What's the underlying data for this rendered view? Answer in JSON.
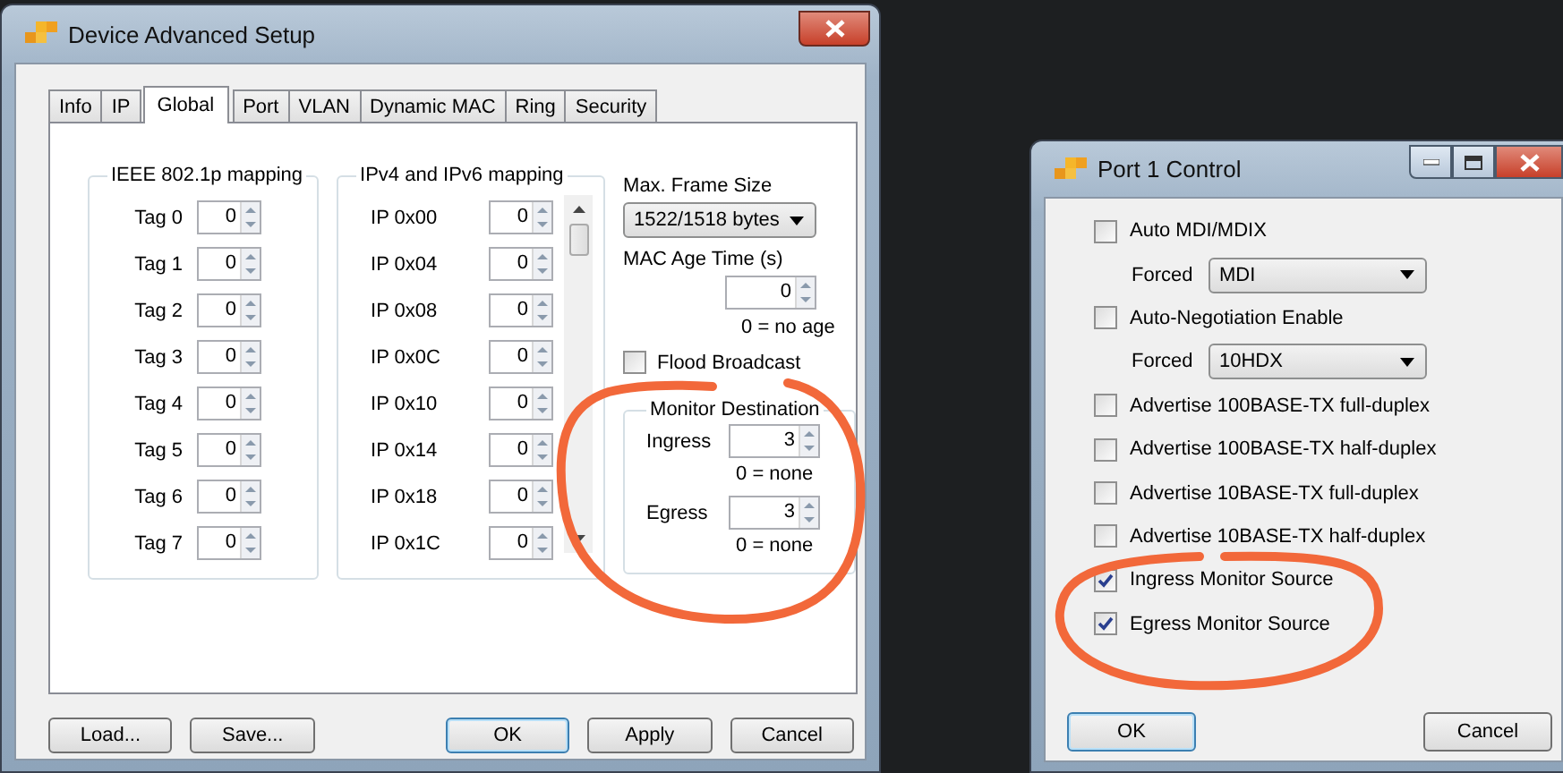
{
  "device_setup": {
    "title": "Device Advanced Setup",
    "tabs": [
      {
        "label": "Info",
        "selected": false
      },
      {
        "label": "IP",
        "selected": false
      },
      {
        "label": "Global",
        "selected": true
      },
      {
        "label": "Port",
        "selected": false
      },
      {
        "label": "VLAN",
        "selected": false
      },
      {
        "label": "Dynamic MAC",
        "selected": false
      },
      {
        "label": "Ring",
        "selected": false
      },
      {
        "label": "Security",
        "selected": false
      }
    ],
    "ieee_mapping": {
      "title": "IEEE 802.1p mapping",
      "rows": [
        {
          "label": "Tag 0",
          "value": "0"
        },
        {
          "label": "Tag 1",
          "value": "0"
        },
        {
          "label": "Tag 2",
          "value": "0"
        },
        {
          "label": "Tag 3",
          "value": "0"
        },
        {
          "label": "Tag 4",
          "value": "0"
        },
        {
          "label": "Tag 5",
          "value": "0"
        },
        {
          "label": "Tag 6",
          "value": "0"
        },
        {
          "label": "Tag 7",
          "value": "0"
        }
      ]
    },
    "ip_mapping": {
      "title": "IPv4 and IPv6 mapping",
      "rows": [
        {
          "label": "IP 0x00",
          "value": "0"
        },
        {
          "label": "IP 0x04",
          "value": "0"
        },
        {
          "label": "IP 0x08",
          "value": "0"
        },
        {
          "label": "IP 0x0C",
          "value": "0"
        },
        {
          "label": "IP 0x10",
          "value": "0"
        },
        {
          "label": "IP 0x14",
          "value": "0"
        },
        {
          "label": "IP 0x18",
          "value": "0"
        },
        {
          "label": "IP 0x1C",
          "value": "0"
        }
      ]
    },
    "max_frame_size": {
      "label": "Max. Frame Size",
      "value": "1522/1518 bytes"
    },
    "mac_age_time": {
      "label": "MAC Age Time (s)",
      "value": "0",
      "hint": "0 = no age"
    },
    "flood_broadcast": {
      "label": "Flood Broadcast",
      "checked": false
    },
    "monitor_destination": {
      "title": "Monitor Destination",
      "fields": [
        {
          "label": "Ingress",
          "value": "3",
          "hint": "0 = none"
        },
        {
          "label": "Egress",
          "value": "3",
          "hint": "0 = none"
        }
      ]
    },
    "buttons": [
      {
        "label": "Load...",
        "focused": false
      },
      {
        "label": "Save...",
        "focused": false
      },
      {
        "label": "OK",
        "focused": true
      },
      {
        "label": "Apply",
        "focused": false
      },
      {
        "label": "Cancel",
        "focused": false
      }
    ]
  },
  "port_control": {
    "title": "Port 1 Control",
    "options": [
      {
        "kind": "checkbox",
        "label": "Auto MDI/MDIX",
        "checked": false
      },
      {
        "kind": "dropdown",
        "label": "Forced",
        "value": "MDI"
      },
      {
        "kind": "checkbox",
        "label": "Auto-Negotiation Enable",
        "checked": false
      },
      {
        "kind": "dropdown",
        "label": "Forced",
        "value": "10HDX"
      },
      {
        "kind": "checkbox",
        "label": "Advertise 100BASE-TX full-duplex",
        "checked": false
      },
      {
        "kind": "checkbox",
        "label": "Advertise 100BASE-TX half-duplex",
        "checked": false
      },
      {
        "kind": "checkbox",
        "label": "Advertise 10BASE-TX full-duplex",
        "checked": false
      },
      {
        "kind": "checkbox",
        "label": "Advertise 10BASE-TX half-duplex",
        "checked": false
      },
      {
        "kind": "checkbox",
        "label": "Ingress Monitor Source",
        "checked": true
      },
      {
        "kind": "checkbox",
        "label": "Egress Monitor Source",
        "checked": true
      }
    ],
    "buttons": [
      {
        "label": "OK",
        "focused": true
      },
      {
        "label": "Cancel",
        "focused": false
      }
    ]
  },
  "annotations": [
    {
      "kind": "circle"
    },
    {
      "kind": "circle"
    }
  ]
}
